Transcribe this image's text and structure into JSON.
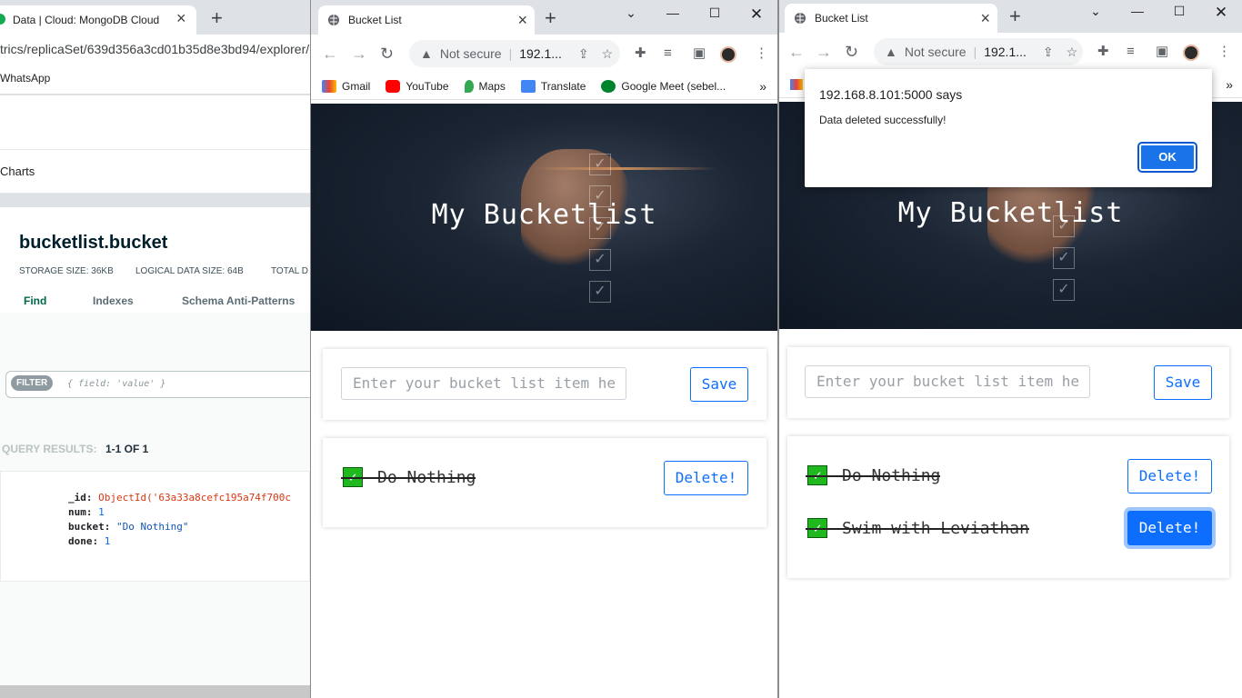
{
  "mongo": {
    "tab_title": "Data | Cloud: MongoDB Cloud",
    "url": "trics/replicaSet/639d356a3cd01b35d8e3bd94/explorer/",
    "bookmark": "WhatsApp",
    "nav_item": "Charts",
    "collection": "bucketlist.bucket",
    "storage_size": "STORAGE SIZE: 36KB",
    "logical_size": "LOGICAL DATA SIZE: 64B",
    "total": "TOTAL D",
    "tabs": [
      "Find",
      "Indexes",
      "Schema Anti-Patterns"
    ],
    "filter_badge": "FILTER",
    "filter_placeholder": "{ field: 'value' }",
    "query_results_label": "QUERY RESULTS:",
    "query_results_value": "1-1 OF 1",
    "doc": {
      "id_key": "_id:",
      "id_val": "ObjectId('63a33a8cefc195a74f700c",
      "num_key": "num:",
      "num_val": "1",
      "bucket_key": "bucket:",
      "bucket_val": "\"Do Nothing\"",
      "done_key": "done:",
      "done_val": "1"
    }
  },
  "browser_a": {
    "tab_title": "Bucket List",
    "not_secure": "Not secure",
    "url": "192.1...",
    "bookmarks": [
      "Gmail",
      "YouTube",
      "Maps",
      "Translate",
      "Google Meet (sebel..."
    ],
    "hero_title": "My Bucketlist",
    "input_placeholder": "Enter your bucket list item he",
    "save_label": "Save",
    "items": [
      {
        "text": "Do Nothing",
        "delete": "Delete!"
      }
    ]
  },
  "browser_b": {
    "tab_title": "Bucket List",
    "not_secure": "Not secure",
    "url": "192.1...",
    "hero_title": "My Bucketlist",
    "input_placeholder": "Enter your bucket list item he",
    "save_label": "Save",
    "items": [
      {
        "text": "Do Nothing",
        "delete": "Delete!"
      },
      {
        "text": "Swim with Leviathan",
        "delete": "Delete!"
      }
    ],
    "dialog": {
      "origin": "192.168.8.101:5000 says",
      "message": "Data deleted successfully!",
      "ok": "OK"
    }
  },
  "colors": {
    "accent": "#0d6efd",
    "check": "#1fb91f",
    "mongo_green": "#00684a",
    "objectid": "#d83713"
  }
}
